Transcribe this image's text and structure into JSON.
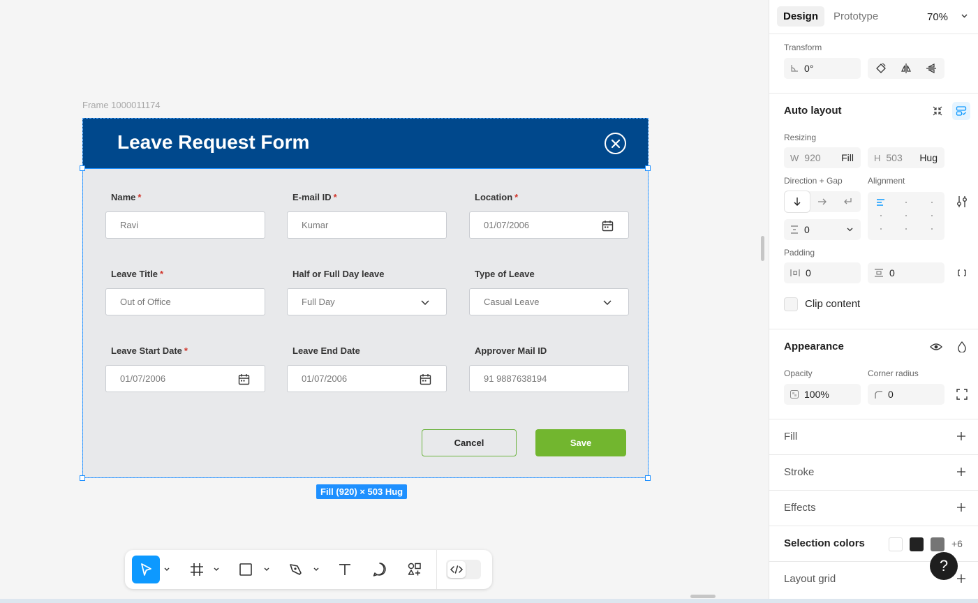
{
  "canvas": {
    "frame_label": "Frame 1000011174",
    "size_badge": "Fill (920) × 503 Hug"
  },
  "form": {
    "title": "Leave Request Form",
    "fields": [
      {
        "label": "Name",
        "required": true,
        "value": "Ravi",
        "icon": null
      },
      {
        "label": "E-mail ID",
        "required": true,
        "value": "Kumar",
        "icon": null
      },
      {
        "label": "Location",
        "required": true,
        "value": "01/07/2006",
        "icon": "calendar-icon"
      },
      {
        "label": "Leave Title",
        "required": true,
        "value": "Out of Office",
        "icon": null
      },
      {
        "label": "Half or Full Day leave",
        "required": false,
        "value": "Full Day",
        "icon": "chevron-down-icon"
      },
      {
        "label": "Type of Leave",
        "required": false,
        "value": "Casual Leave",
        "icon": "chevron-down-icon"
      },
      {
        "label": "Leave Start Date",
        "required": true,
        "value": "01/07/2006",
        "icon": "calendar-icon"
      },
      {
        "label": "Leave End Date",
        "required": false,
        "value": "01/07/2006",
        "icon": "calendar-icon"
      },
      {
        "label": "Approver Mail ID",
        "required": false,
        "value": "91 9887638194",
        "icon": null
      }
    ],
    "required_mark": "*",
    "cancel_label": "Cancel",
    "save_label": "Save"
  },
  "panel": {
    "tab_design": "Design",
    "tab_prototype": "Prototype",
    "zoom": "70%",
    "transform": {
      "heading": "Transform",
      "rotation": "0°"
    },
    "auto_layout": {
      "heading": "Auto layout",
      "resizing_label": "Resizing",
      "w_prefix": "W",
      "w_value": "920",
      "w_mode": "Fill",
      "h_prefix": "H",
      "h_value": "503",
      "h_mode": "Hug",
      "direction_label": "Direction + Gap",
      "alignment_label": "Alignment",
      "gap_value": "0",
      "padding_label": "Padding",
      "padding_h": "0",
      "padding_v": "0",
      "clip_label": "Clip content"
    },
    "appearance": {
      "heading": "Appearance",
      "opacity_label": "Opacity",
      "opacity_value": "100%",
      "radius_label": "Corner radius",
      "radius_value": "0"
    },
    "fill_heading": "Fill",
    "stroke_heading": "Stroke",
    "effects_heading": "Effects",
    "selection_colors": {
      "heading": "Selection colors",
      "swatches": [
        "#ffffff",
        "#222222",
        "#757575"
      ],
      "more": "+6"
    },
    "layout_grid_heading": "Layout grid"
  },
  "help_label": "?",
  "colors": {
    "header_blue": "#00488c",
    "save_green": "#72b62f",
    "selection_blue": "#1e90ff",
    "required_red": "#d0352b"
  }
}
